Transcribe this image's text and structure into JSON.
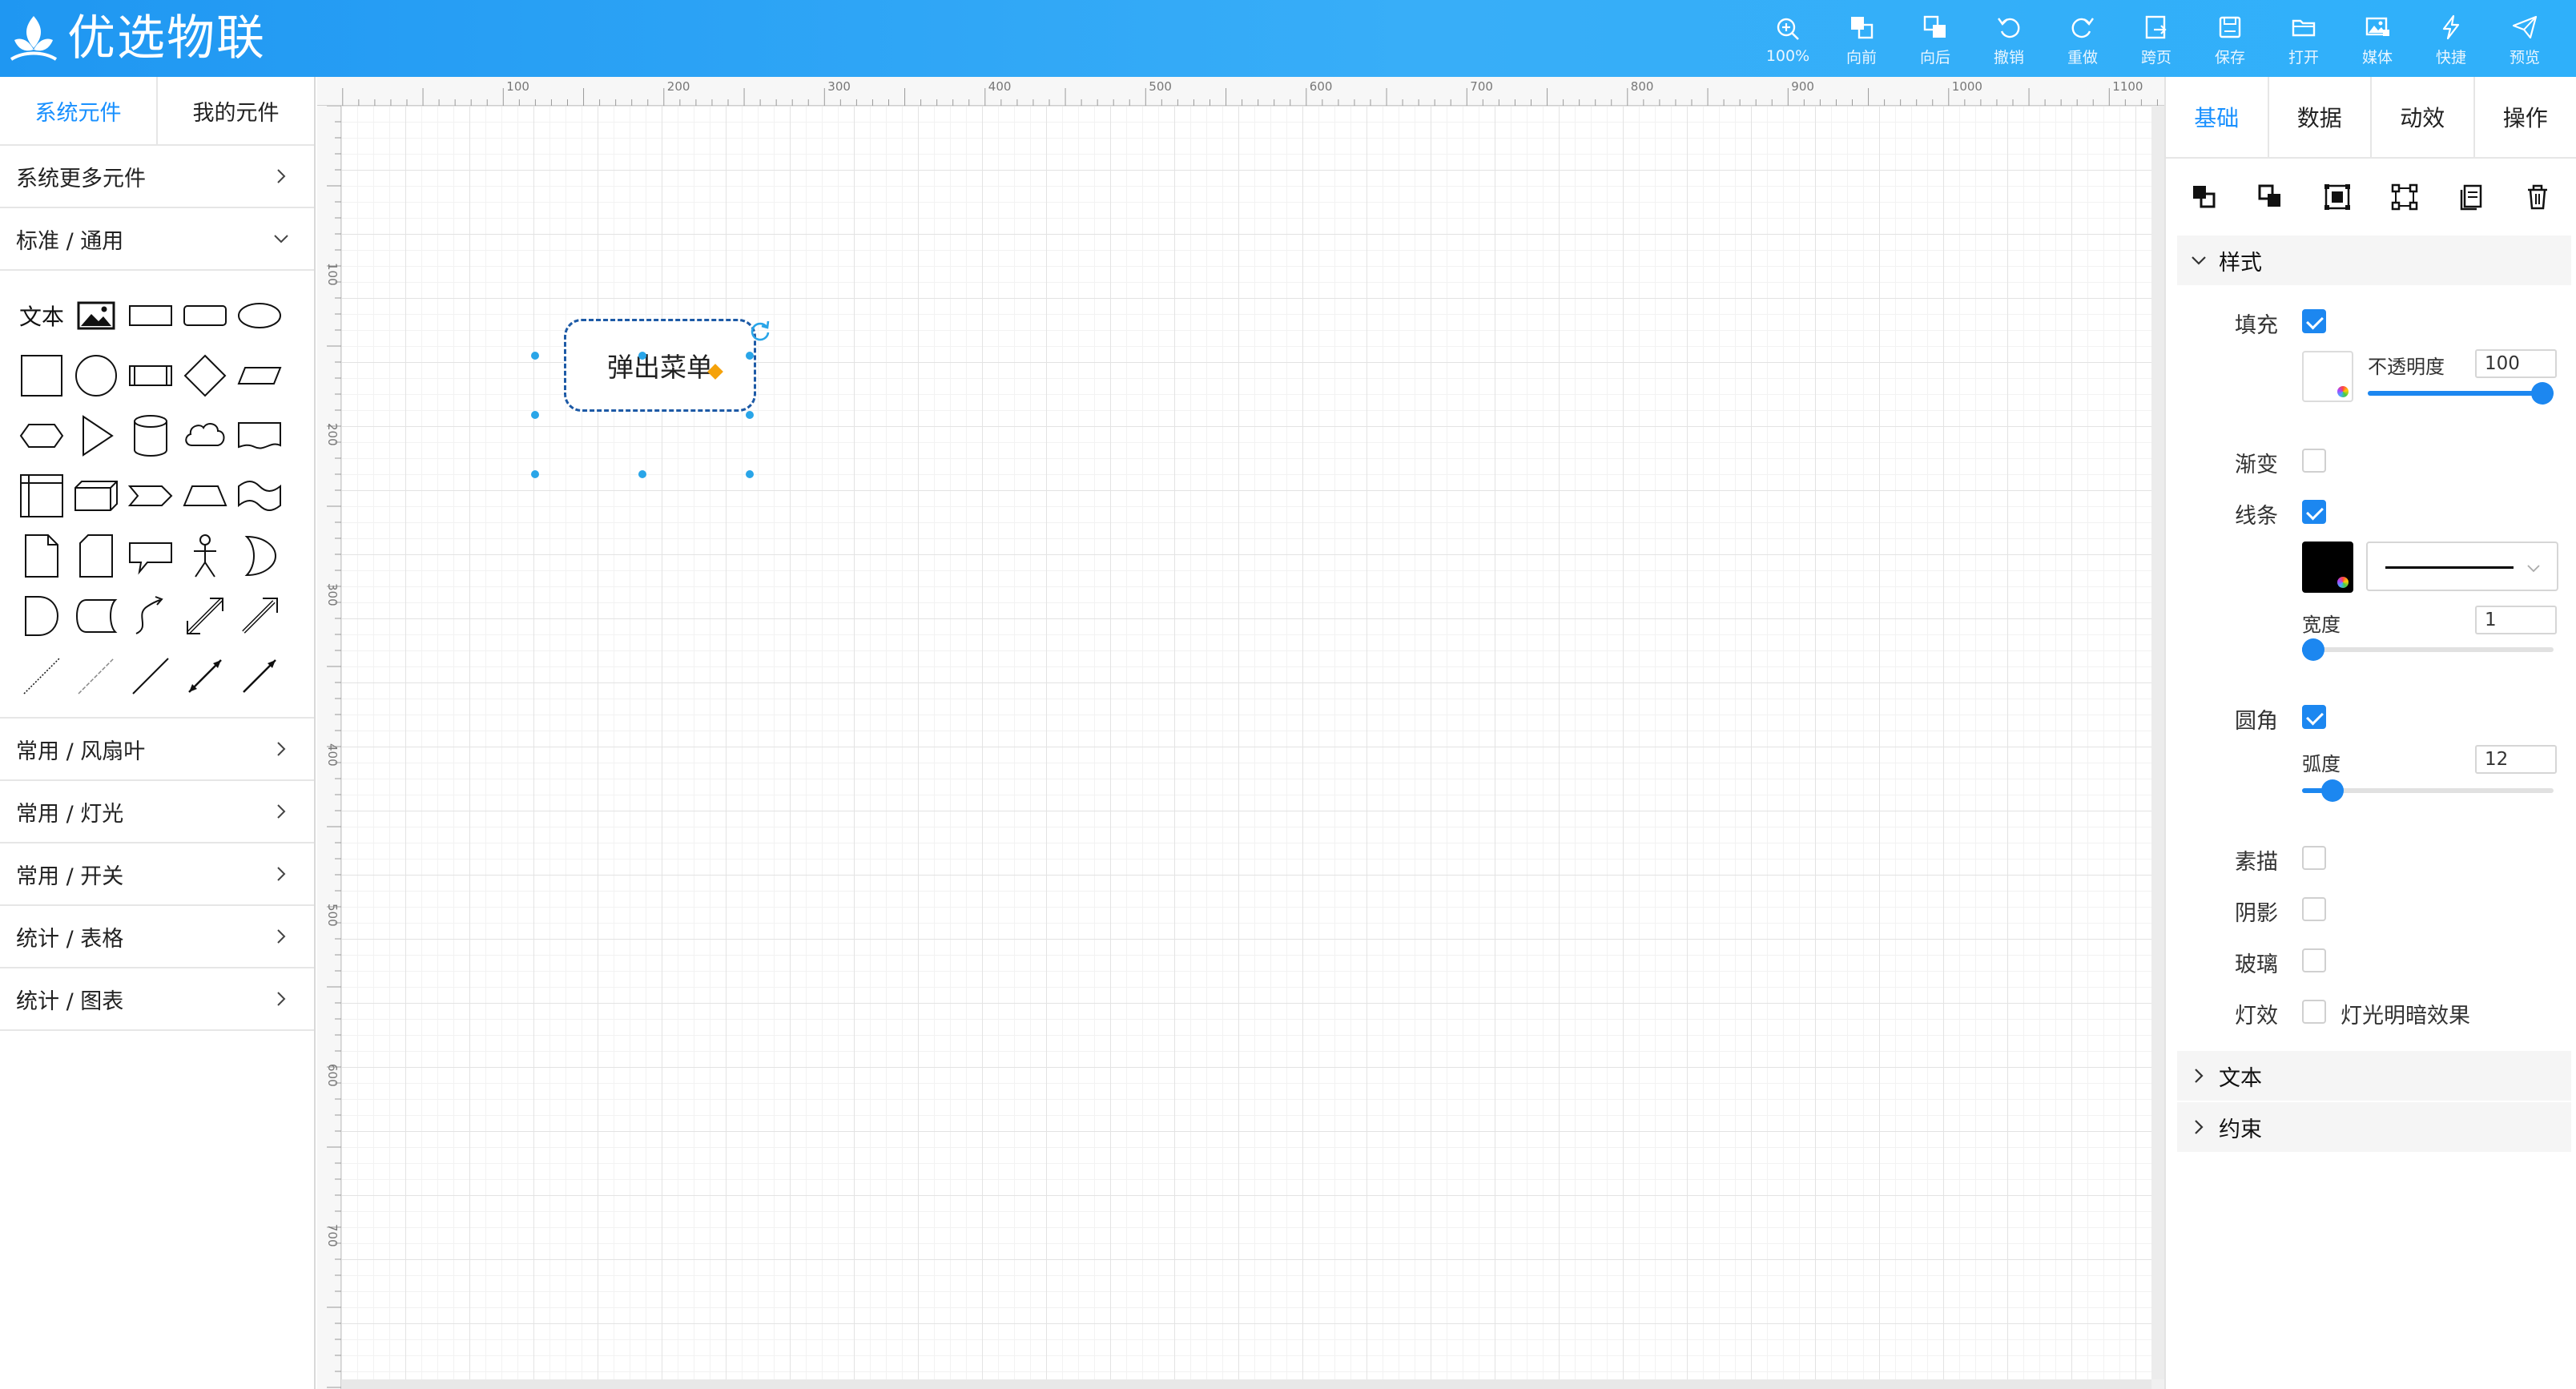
{
  "app": {
    "title": "优选物联",
    "toolbar": [
      {
        "icon": "zoom-icon",
        "label": "100%"
      },
      {
        "icon": "bring-forward-icon",
        "label": "向前"
      },
      {
        "icon": "send-backward-icon",
        "label": "向后"
      },
      {
        "icon": "undo-icon",
        "label": "撤销"
      },
      {
        "icon": "redo-icon",
        "label": "重做"
      },
      {
        "icon": "cross-page-icon",
        "label": "跨页"
      },
      {
        "icon": "save-icon",
        "label": "保存"
      },
      {
        "icon": "open-folder-icon",
        "label": "打开"
      },
      {
        "icon": "media-icon",
        "label": "媒体"
      },
      {
        "icon": "lightning-icon",
        "label": "快捷"
      },
      {
        "icon": "send-icon",
        "label": "预览"
      }
    ]
  },
  "left": {
    "tabs": [
      "系统元件",
      "我的元件"
    ],
    "more": "系统更多元件",
    "standard": "标准 / 通用",
    "text_shape": "文本",
    "categories": [
      "常用 / 风扇叶",
      "常用 / 灯光",
      "常用 / 开关",
      "统计 / 表格",
      "统计 / 图表"
    ]
  },
  "canvas": {
    "ruler_x": [
      "100",
      "200",
      "300",
      "400",
      "500",
      "600",
      "700",
      "800",
      "900",
      "1000",
      "1100"
    ],
    "ruler_y": [
      "100",
      "200",
      "300",
      "400",
      "500",
      "600",
      "700"
    ],
    "node_label": "弹出菜单"
  },
  "right": {
    "tabs": [
      "基础",
      "数据",
      "动效",
      "操作"
    ],
    "style_section": "样式",
    "fill": "填充",
    "opacity_label": "不透明度",
    "opacity_value": "100",
    "gradient": "渐变",
    "stroke": "线条",
    "width_label": "宽度",
    "width_value": "1",
    "corner": "圆角",
    "radius_label": "弧度",
    "radius_value": "12",
    "sketch": "素描",
    "shadow": "阴影",
    "glass": "玻璃",
    "light": "灯效",
    "light_desc": "灯光明暗效果",
    "text_section": "文本",
    "constraint_section": "约束",
    "values": {
      "fill": true,
      "gradient": false,
      "stroke": true,
      "corner": true,
      "sketch": false,
      "shadow": false,
      "glass": false,
      "light": false,
      "opacity": 100,
      "opacity_max": 100,
      "stroke_width": 1,
      "stroke_width_max": 100,
      "radius": 12,
      "radius_max": 100
    }
  },
  "colors": {
    "header": "#2aa6f5",
    "accent": "#1890ff",
    "handle": "#29a5e8",
    "anchor": "#f5a20a"
  }
}
